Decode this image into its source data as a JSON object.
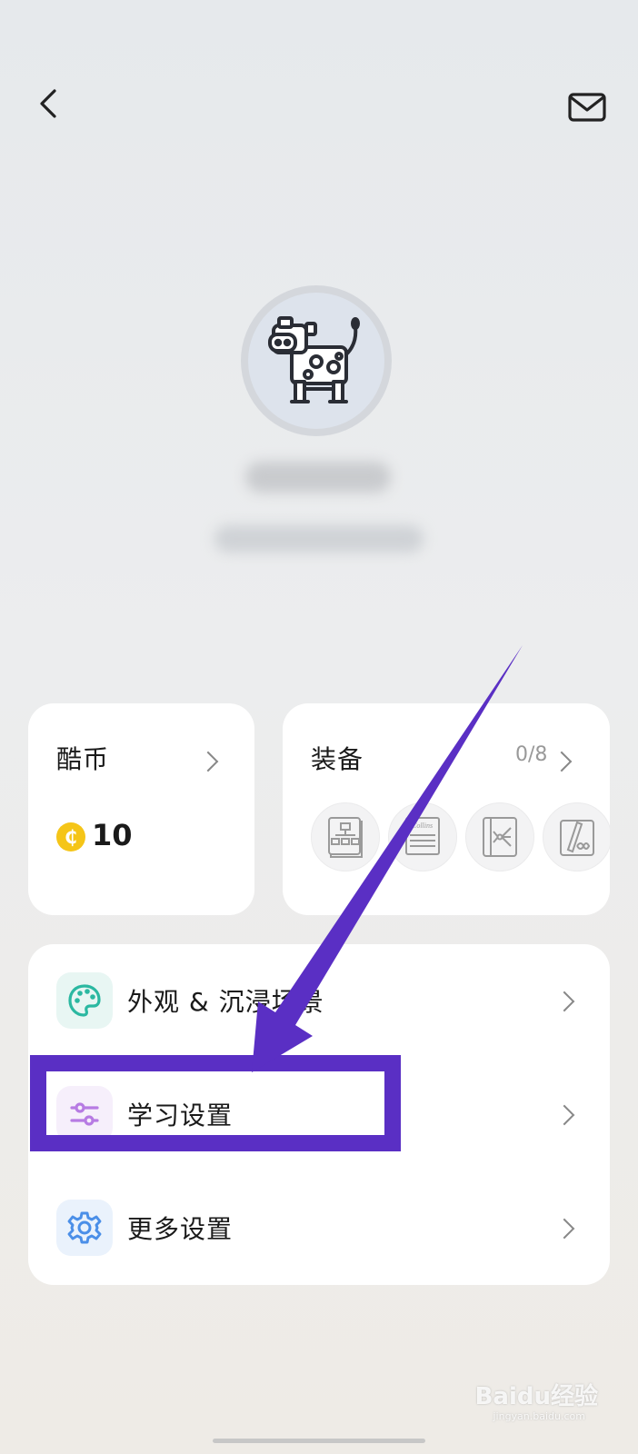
{
  "header": {
    "back_icon": "chevron-left-icon",
    "mail_icon": "mail-icon"
  },
  "profile": {
    "avatar_icon": "cow-avatar-icon"
  },
  "coins_card": {
    "title": "酷币",
    "amount": "10",
    "coin_symbol": "₵",
    "coin_color": "#f5c518"
  },
  "equipment_card": {
    "title": "装备",
    "count": "0/8",
    "items": [
      {
        "icon": "flowchart-book-icon"
      },
      {
        "icon": "collins-book-icon",
        "brand": "Collins"
      },
      {
        "icon": "mindmap-book-icon"
      },
      {
        "icon": "pen-notebook-icon"
      }
    ]
  },
  "menu": {
    "items": [
      {
        "label": "外观 & 沉浸场景",
        "icon": "palette-icon",
        "icon_color": "#2bb8a1",
        "icon_bg": "#e8f6f3"
      },
      {
        "label": "学习设置",
        "icon": "sliders-icon",
        "icon_color": "#b77be3",
        "icon_bg": "#f6effb"
      },
      {
        "label": "更多设置",
        "icon": "gear-icon",
        "icon_color": "#4b8fe8",
        "icon_bg": "#eaf2fc"
      }
    ]
  },
  "annotation": {
    "color": "#5a2fc4"
  },
  "watermark": {
    "brand": "Bai",
    "paw": "du",
    "suffix": "经验",
    "site": "jingyan.baidu.com"
  }
}
